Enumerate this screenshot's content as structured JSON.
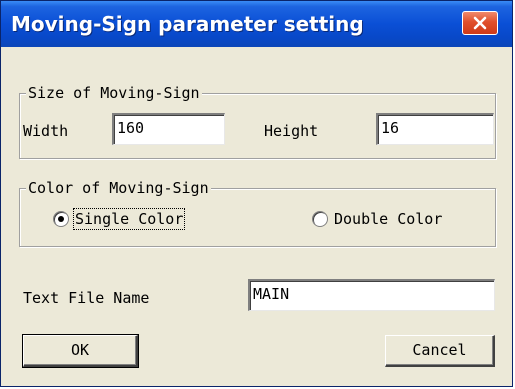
{
  "window": {
    "title": "Moving-Sign parameter setting",
    "close_glyph": "✕"
  },
  "size_group": {
    "legend": "Size of Moving-Sign",
    "width_label": "Width",
    "width_value": "160",
    "height_label": "Height",
    "height_value": "16"
  },
  "color_group": {
    "legend": "Color of Moving-Sign",
    "options": [
      {
        "label": "Single Color",
        "selected": true
      },
      {
        "label": "Double Color",
        "selected": false
      }
    ]
  },
  "text_file": {
    "label": "Text File Name",
    "value": "MAIN"
  },
  "buttons": {
    "ok_label": "OK",
    "cancel_label": "Cancel"
  },
  "colors": {
    "titlebar": "#0a4fd6",
    "close_button": "#e0502c",
    "dialog_background": "#ece9d8"
  }
}
